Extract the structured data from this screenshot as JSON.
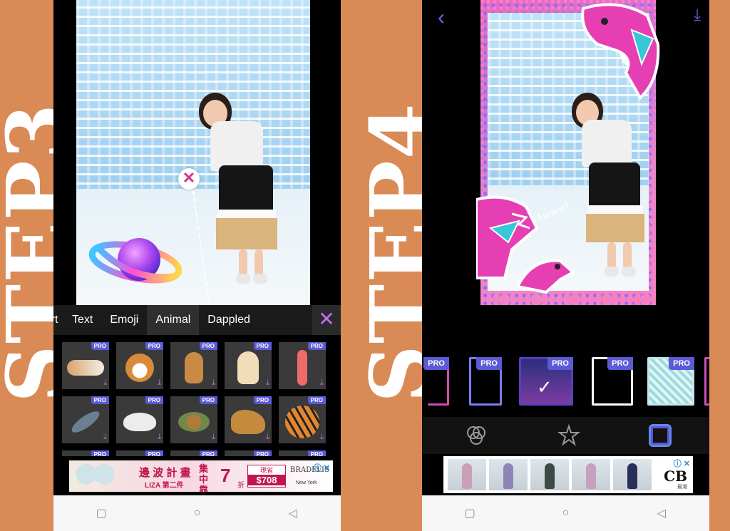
{
  "step3": {
    "label": "STEP3",
    "tabs": [
      {
        "label": "Art",
        "state": "partial"
      },
      {
        "label": "Text",
        "state": "normal"
      },
      {
        "label": "Emoji",
        "state": "normal"
      },
      {
        "label": "Animal",
        "state": "active"
      },
      {
        "label": "Dappled",
        "state": "normal"
      }
    ],
    "close_glyph": "✕",
    "delete_glyph": "✕",
    "pro_badge": "PRO",
    "stickers_row1": [
      "cat-and-dog",
      "corgi",
      "cat",
      "puppy",
      "flamingo"
    ],
    "stickers_row2": [
      "dolphin",
      "swan",
      "sea-turtle",
      "lion",
      "tiger"
    ],
    "ad": {
      "headline": "邊 波 計 畫",
      "sub": "LIZA 第二件",
      "vertical": "集中靠拢",
      "discount_num": "7",
      "discount_unit": "折",
      "price_label": "現省",
      "price": "$708",
      "brand": "BRADELIS",
      "brand_sub": "New York",
      "choice": "ⓘ ✕"
    }
  },
  "step4": {
    "label": "STEP4",
    "back_glyph": "‹",
    "download_glyph": "⤓",
    "doodle": "Awwwl",
    "pro_badge": "PRO",
    "check_glyph": "✓",
    "ad": {
      "brand": "CB",
      "brand_sub": "最潮",
      "choice": "ⓘ ✕"
    }
  },
  "nav": {
    "square": "▢",
    "circle": "○",
    "back": "◁"
  },
  "colors": {
    "background": "#d98a55",
    "accent_purple": "#c36cf2",
    "pro_badge": "#5b5bd6",
    "frame_active": "#5a8ee6"
  }
}
